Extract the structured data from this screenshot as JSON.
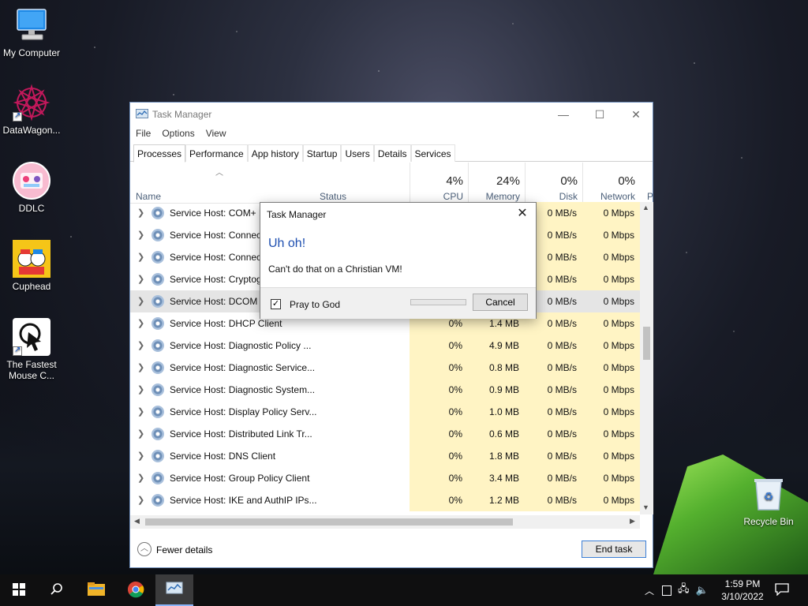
{
  "desktop": {
    "icons": [
      {
        "label": "My Computer",
        "icon": "monitor-icon"
      },
      {
        "label": "DataWagon...",
        "icon": "mandala-icon"
      },
      {
        "label": "DDLC",
        "icon": "ddlc-icon"
      },
      {
        "label": "Cuphead",
        "icon": "cuphead-icon"
      },
      {
        "label": "The Fastest Mouse C...",
        "icon": "cursor-icon"
      },
      {
        "label": "Recycle Bin",
        "icon": "recycle-bin-icon"
      }
    ]
  },
  "taskmanager": {
    "title": "Task Manager",
    "menu": [
      "File",
      "Options",
      "View"
    ],
    "tabs": [
      "Processes",
      "Performance",
      "App history",
      "Startup",
      "Users",
      "Details",
      "Services"
    ],
    "header": {
      "name": "Name",
      "status": "Status",
      "cpu_pct": "4%",
      "cpu": "CPU",
      "mem_pct": "24%",
      "mem": "Memory",
      "disk_pct": "0%",
      "disk": "Disk",
      "net_pct": "0%",
      "net": "Network",
      "extra": "P"
    },
    "rows": [
      {
        "name": "Service Host: COM+ E",
        "cpu": "",
        "mem": "",
        "disk": "0 MB/s",
        "net": "0 Mbps"
      },
      {
        "name": "Service Host: Connect",
        "cpu": "",
        "mem": "",
        "disk": "0 MB/s",
        "net": "0 Mbps"
      },
      {
        "name": "Service Host: Connect",
        "cpu": "",
        "mem": "",
        "disk": "0 MB/s",
        "net": "0 Mbps"
      },
      {
        "name": "Service Host: Cryptog",
        "cpu": "",
        "mem": "",
        "disk": "0 MB/s",
        "net": "0 Mbps"
      },
      {
        "name": "Service Host: DCOM S",
        "cpu": "",
        "mem": "",
        "disk": "0 MB/s",
        "net": "0 Mbps"
      },
      {
        "name": "Service Host: DHCP Client",
        "cpu": "0%",
        "mem": "1.4 MB",
        "disk": "0 MB/s",
        "net": "0 Mbps"
      },
      {
        "name": "Service Host: Diagnostic Policy ...",
        "cpu": "0%",
        "mem": "4.9 MB",
        "disk": "0 MB/s",
        "net": "0 Mbps"
      },
      {
        "name": "Service Host: Diagnostic Service...",
        "cpu": "0%",
        "mem": "0.8 MB",
        "disk": "0 MB/s",
        "net": "0 Mbps"
      },
      {
        "name": "Service Host: Diagnostic System...",
        "cpu": "0%",
        "mem": "0.9 MB",
        "disk": "0 MB/s",
        "net": "0 Mbps"
      },
      {
        "name": "Service Host: Display Policy Serv...",
        "cpu": "0%",
        "mem": "1.0 MB",
        "disk": "0 MB/s",
        "net": "0 Mbps"
      },
      {
        "name": "Service Host: Distributed Link Tr...",
        "cpu": "0%",
        "mem": "0.6 MB",
        "disk": "0 MB/s",
        "net": "0 Mbps"
      },
      {
        "name": "Service Host: DNS Client",
        "cpu": "0%",
        "mem": "1.8 MB",
        "disk": "0 MB/s",
        "net": "0 Mbps"
      },
      {
        "name": "Service Host: Group Policy Client",
        "cpu": "0%",
        "mem": "3.4 MB",
        "disk": "0 MB/s",
        "net": "0 Mbps"
      },
      {
        "name": "Service Host: IKE and AuthIP IPs...",
        "cpu": "0%",
        "mem": "1.2 MB",
        "disk": "0 MB/s",
        "net": "0 Mbps"
      }
    ],
    "footer": {
      "fewer_details": "Fewer details",
      "end_task": "End task"
    }
  },
  "dialog": {
    "title": "Task Manager",
    "heading": "Uh oh!",
    "message": "Can't do that on a Christian VM!",
    "checkbox_label": "Pray to God",
    "checkbox_checked": true,
    "cancel": "Cancel"
  },
  "taskbar": {
    "time": "1:59 PM",
    "date": "3/10/2022"
  }
}
